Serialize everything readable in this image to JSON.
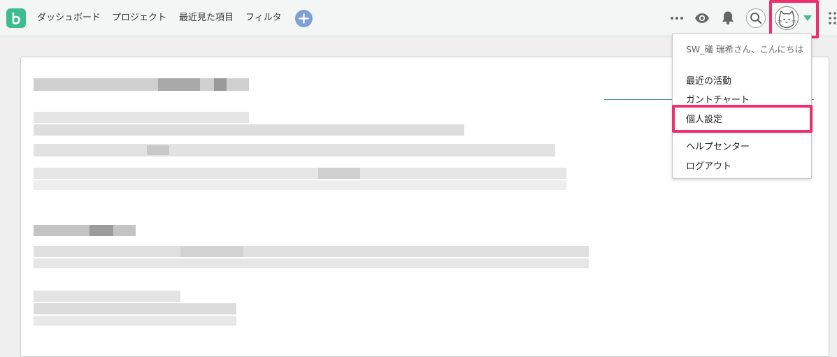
{
  "nav": {
    "items": [
      {
        "label": "ダッシュボード"
      },
      {
        "label": "プロジェクト"
      },
      {
        "label": "最近見た項目"
      },
      {
        "label": "フィルタ"
      }
    ]
  },
  "icons": {
    "logo": "backlog-logo-icon",
    "add": "plus-icon",
    "more": "ellipsis-icon",
    "watch": "eye-icon",
    "notifications": "bell-icon",
    "search": "search-icon",
    "avatar": "cat-avatar-icon",
    "caret": "caret-down-icon",
    "apps": "grid-icon"
  },
  "colors": {
    "brand": "#3dbd8f",
    "highlight": "#ee2f6d",
    "add_button": "#7d9fd6"
  },
  "menu": {
    "greeting": "SW_礒 瑞希さん、こんにちは",
    "items": [
      {
        "label": "最近の活動"
      },
      {
        "label": "ガントチャート"
      },
      {
        "label": "個人設定"
      },
      {
        "label": "ヘルプセンター"
      },
      {
        "label": "ログアウト"
      }
    ]
  }
}
